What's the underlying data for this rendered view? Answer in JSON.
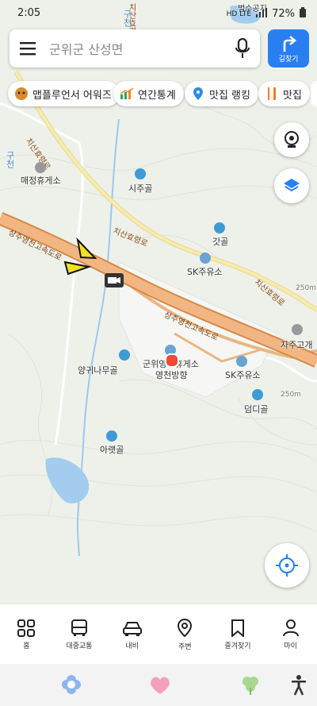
{
  "status_bar": {
    "time": "2:05",
    "battery": "72%",
    "network": "HD LTE"
  },
  "search": {
    "placeholder": "군위군 산성면"
  },
  "route_button": {
    "label": "길찾기"
  },
  "chips": [
    {
      "label": "맵플루언서 어워즈",
      "icon": "trophy-mascot-icon"
    },
    {
      "label": "연간통계",
      "icon": "chart-icon"
    },
    {
      "label": "맛집 랭킹",
      "icon": "pin-icon"
    },
    {
      "label": "맛집",
      "icon": "fork-knife-icon"
    }
  ],
  "map": {
    "labels": {
      "maejeong": "매정휴게소",
      "sijugol": "시주골",
      "gatgol": "갓골",
      "sk1": "SK주유소",
      "sk2": "SK주유소",
      "jajugogae": "자주고개",
      "yanggwi": "양귀나무골",
      "rest_area_line1": "군위영천휴게소",
      "rest_area_line2": "영천방향",
      "deomdigol": "덤디골",
      "araetgol": "아랫골",
      "top_label": "벌수공지",
      "guchon1": "구천",
      "guchon2": "구천"
    },
    "roads": {
      "expressway_top": "상주영천고속도로",
      "expressway_mid": "상주영천고속도로",
      "chisan1": "치산효령로",
      "chisan2": "치산효령로",
      "chisan3": "치산효령로"
    },
    "elevations": {
      "e1": "250m",
      "e2": "250m"
    }
  },
  "bottom_nav": [
    {
      "label": "홈",
      "icon": "grid-icon"
    },
    {
      "label": "대중교통",
      "icon": "bus-icon"
    },
    {
      "label": "내비",
      "icon": "car-icon"
    },
    {
      "label": "주변",
      "icon": "location-pin-icon"
    },
    {
      "label": "즐겨찾기",
      "icon": "bookmark-icon"
    },
    {
      "label": "마이",
      "icon": "person-icon"
    }
  ]
}
